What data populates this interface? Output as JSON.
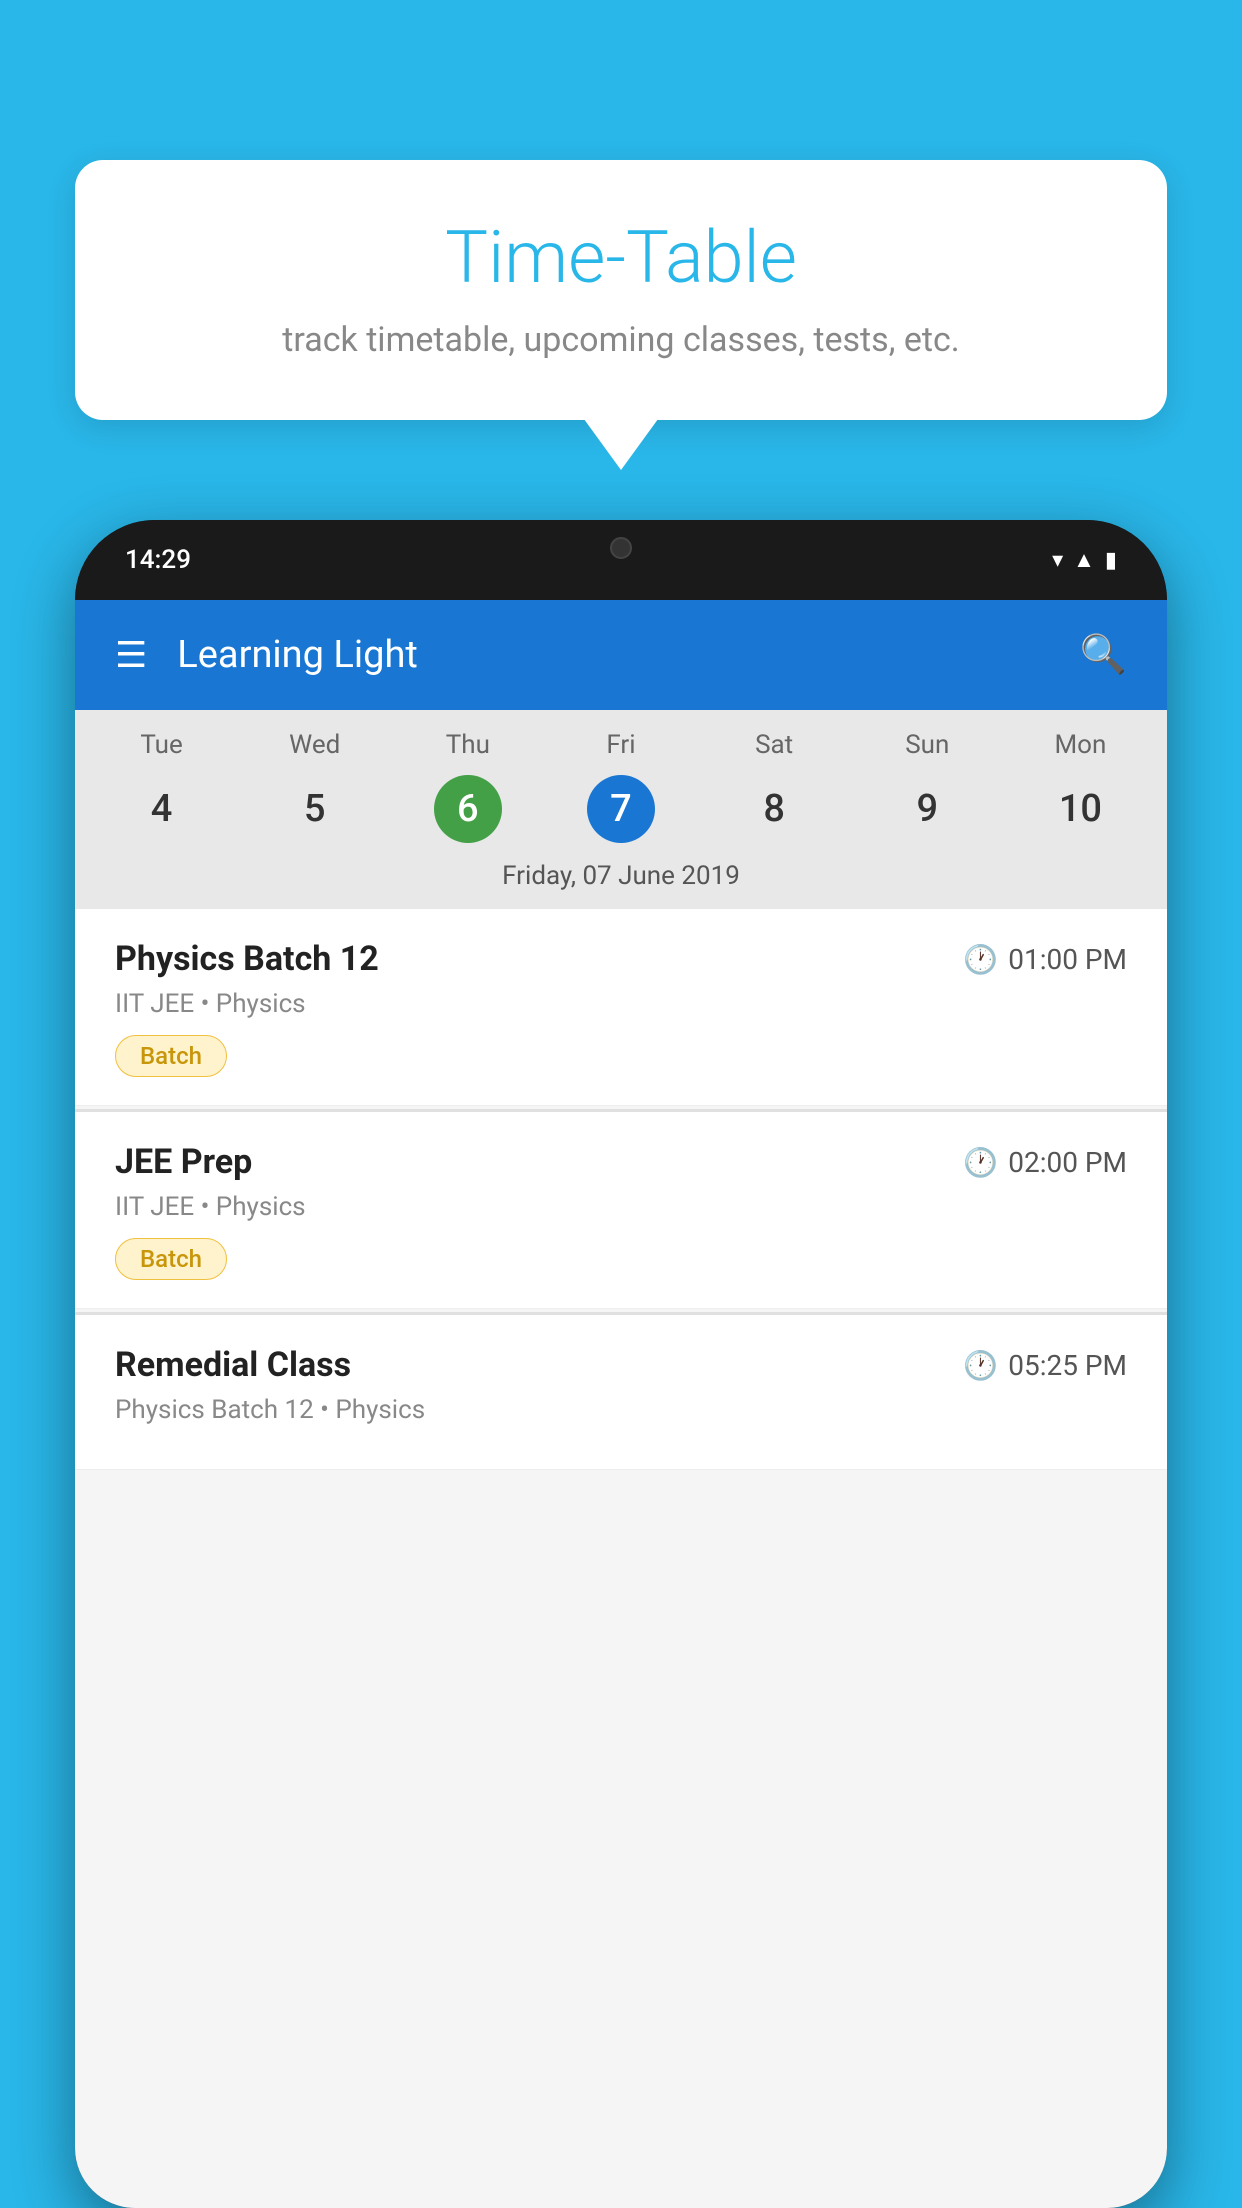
{
  "page": {
    "background_color": "#29b6e8"
  },
  "speech_bubble": {
    "title": "Time-Table",
    "subtitle": "track timetable, upcoming classes, tests, etc."
  },
  "phone": {
    "status_bar": {
      "time": "14:29"
    },
    "app_bar": {
      "title": "Learning Light"
    },
    "calendar": {
      "days": [
        {
          "label": "Tue",
          "number": "4",
          "state": "normal"
        },
        {
          "label": "Wed",
          "number": "5",
          "state": "normal"
        },
        {
          "label": "Thu",
          "number": "6",
          "state": "today"
        },
        {
          "label": "Fri",
          "number": "7",
          "state": "selected"
        },
        {
          "label": "Sat",
          "number": "8",
          "state": "normal"
        },
        {
          "label": "Sun",
          "number": "9",
          "state": "normal"
        },
        {
          "label": "Mon",
          "number": "10",
          "state": "normal"
        }
      ],
      "selected_date_label": "Friday, 07 June 2019"
    },
    "classes": [
      {
        "name": "Physics Batch 12",
        "time": "01:00 PM",
        "detail": "IIT JEE • Physics",
        "badge": "Batch"
      },
      {
        "name": "JEE Prep",
        "time": "02:00 PM",
        "detail": "IIT JEE • Physics",
        "badge": "Batch"
      },
      {
        "name": "Remedial Class",
        "time": "05:25 PM",
        "detail": "Physics Batch 12 • Physics",
        "badge": null
      }
    ]
  }
}
